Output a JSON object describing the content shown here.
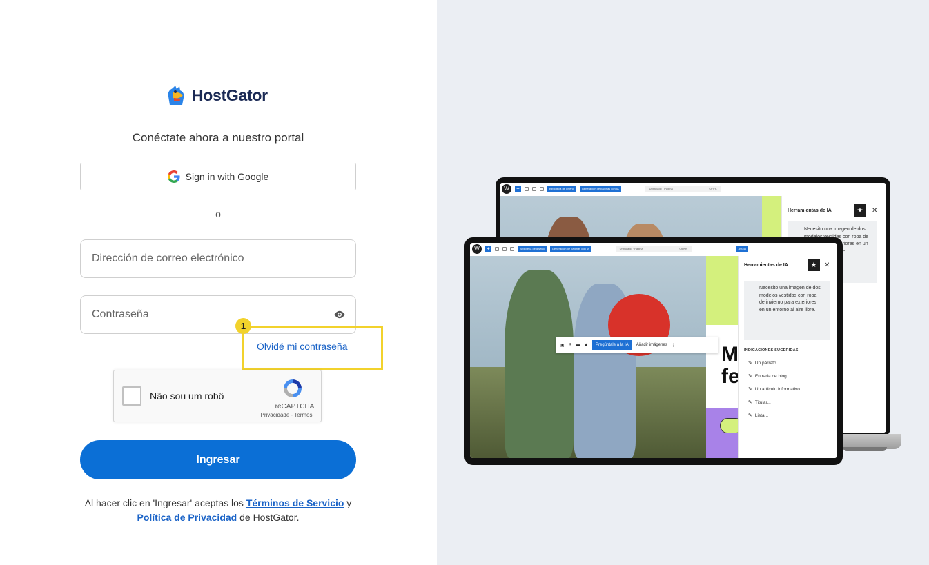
{
  "brand": {
    "name": "HostGator"
  },
  "login": {
    "tagline": "Conéctate ahora a nuestro portal",
    "google_label": "Sign in with Google",
    "divider": "o",
    "email_placeholder": "Dirección de correo electrónico",
    "password_placeholder": "Contraseña",
    "forgot": "Olvidé mi contraseña",
    "annotation_number": "1",
    "captcha": {
      "label": "Não sou um robô",
      "brand": "reCAPTCHA",
      "links": "Privacidade - Termos"
    },
    "submit": "Ingresar",
    "legal": {
      "before": "Al hacer clic en 'Ingresar' aceptas los ",
      "terms": "Términos de Servicio",
      "and": " y ",
      "privacy": "Política de Privacidad",
      "after": " de HostGator."
    }
  },
  "colors": {
    "primary": "#0b6fd6",
    "highlight": "#f2d22c",
    "right_bg": "#ebeef3",
    "link": "#1a63c7"
  },
  "promo": {
    "toolbar": {
      "design_library": "Biblioteca de diseño",
      "page_generator": "Generación de páginas con IA",
      "doc_title": "Untitulado · Página",
      "shortcut": "Ctrl+K",
      "save_draft": "Guardar borrador",
      "help": "Ayuda"
    },
    "ai_panel": {
      "title": "Herramientas de IA",
      "prompt": "Necesito una imagen de dos modelos vestidas con ropa de invierno para exteriores en un entorno al aire libre.",
      "suggestions_title": "INDICACIONES SUGERIDAS",
      "suggestions": [
        "Un párrafo...",
        "Entrada de blog...",
        "Un artículo informativo...",
        "Titular...",
        "Lista..."
      ]
    },
    "block_toolbar": {
      "ask_ai": "Pregúntale a la IA",
      "add_images": "Añadir imágenes"
    },
    "big_text": {
      "line1": "M",
      "line2": "fe"
    }
  }
}
